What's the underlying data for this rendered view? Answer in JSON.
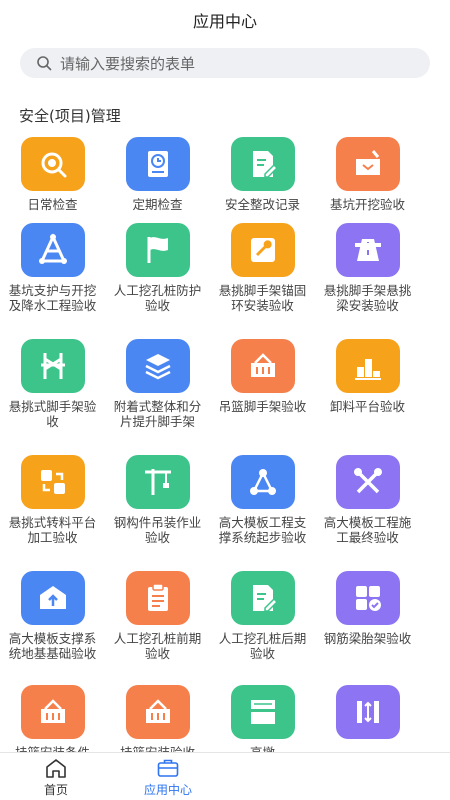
{
  "header": {
    "title": "应用中心"
  },
  "search": {
    "placeholder": "请输入要搜索的表单"
  },
  "section": {
    "title": "安全(项目)管理"
  },
  "apps": [
    {
      "label": "日常检查",
      "color": "#f7a21b",
      "icon": "magnify-icon"
    },
    {
      "label": "定期检查",
      "color": "#4b87f3",
      "icon": "clock-book-icon"
    },
    {
      "label": "安全整改记录",
      "color": "#3cc48b",
      "icon": "edit-doc-icon"
    },
    {
      "label": "基坑开挖验收",
      "color": "#f6804b",
      "icon": "excavation-icon"
    },
    {
      "label": "基坑支护与开挖及降水工程验收",
      "color": "#4b87f3",
      "icon": "structure-icon"
    },
    {
      "label": "人工挖孔桩防护验收",
      "color": "#3cc48b",
      "icon": "flag-icon"
    },
    {
      "label": "悬挑脚手架锚固环安装验收",
      "color": "#f7a21b",
      "icon": "wrench-icon"
    },
    {
      "label": "悬挑脚手架悬挑梁安装验收",
      "color": "#8c74f2",
      "icon": "road-icon"
    },
    {
      "label": "悬挑式脚手架验收",
      "color": "#3cc48b",
      "icon": "scaffold-icon"
    },
    {
      "label": "附着式整体和分片提升脚手架",
      "color": "#4b87f3",
      "icon": "layers-icon"
    },
    {
      "label": "吊篮脚手架验收",
      "color": "#f6804b",
      "icon": "basket-icon"
    },
    {
      "label": "卸料平台验收",
      "color": "#f7a21b",
      "icon": "platform-icon"
    },
    {
      "label": "悬挑式转料平台加工验收",
      "color": "#f7a21b",
      "icon": "transfer-icon"
    },
    {
      "label": "钢构件吊装作业验收",
      "color": "#3cc48b",
      "icon": "crane-icon"
    },
    {
      "label": "高大模板工程支撑系统起步验收",
      "color": "#4b87f3",
      "icon": "nodes-icon"
    },
    {
      "label": "高大模板工程施工最终验收",
      "color": "#8c74f2",
      "icon": "tools-icon"
    },
    {
      "label": "高大模板支撑系统地基基础验收",
      "color": "#4b87f3",
      "icon": "upload-box-icon"
    },
    {
      "label": "人工挖孔桩前期验收",
      "color": "#f6804b",
      "icon": "clipboard-icon"
    },
    {
      "label": "人工挖孔桩后期验收",
      "color": "#3cc48b",
      "icon": "edit-doc-icon"
    },
    {
      "label": "钢筋梁胎架验收",
      "color": "#8c74f2",
      "icon": "grid-check-icon"
    },
    {
      "label": "挂篮安装条件",
      "color": "#f6804b",
      "icon": "basket-icon"
    },
    {
      "label": "挂篮安装验收",
      "color": "#f6804b",
      "icon": "basket-icon"
    },
    {
      "label": "高墩",
      "color": "#3cc48b",
      "icon": "pier-icon"
    },
    {
      "label": "",
      "color": "#8c74f2",
      "icon": "column-icon"
    }
  ],
  "tabbar": {
    "items": [
      {
        "label": "首页",
        "icon": "home-icon"
      },
      {
        "label": "应用中心",
        "icon": "briefcase-icon"
      }
    ]
  }
}
